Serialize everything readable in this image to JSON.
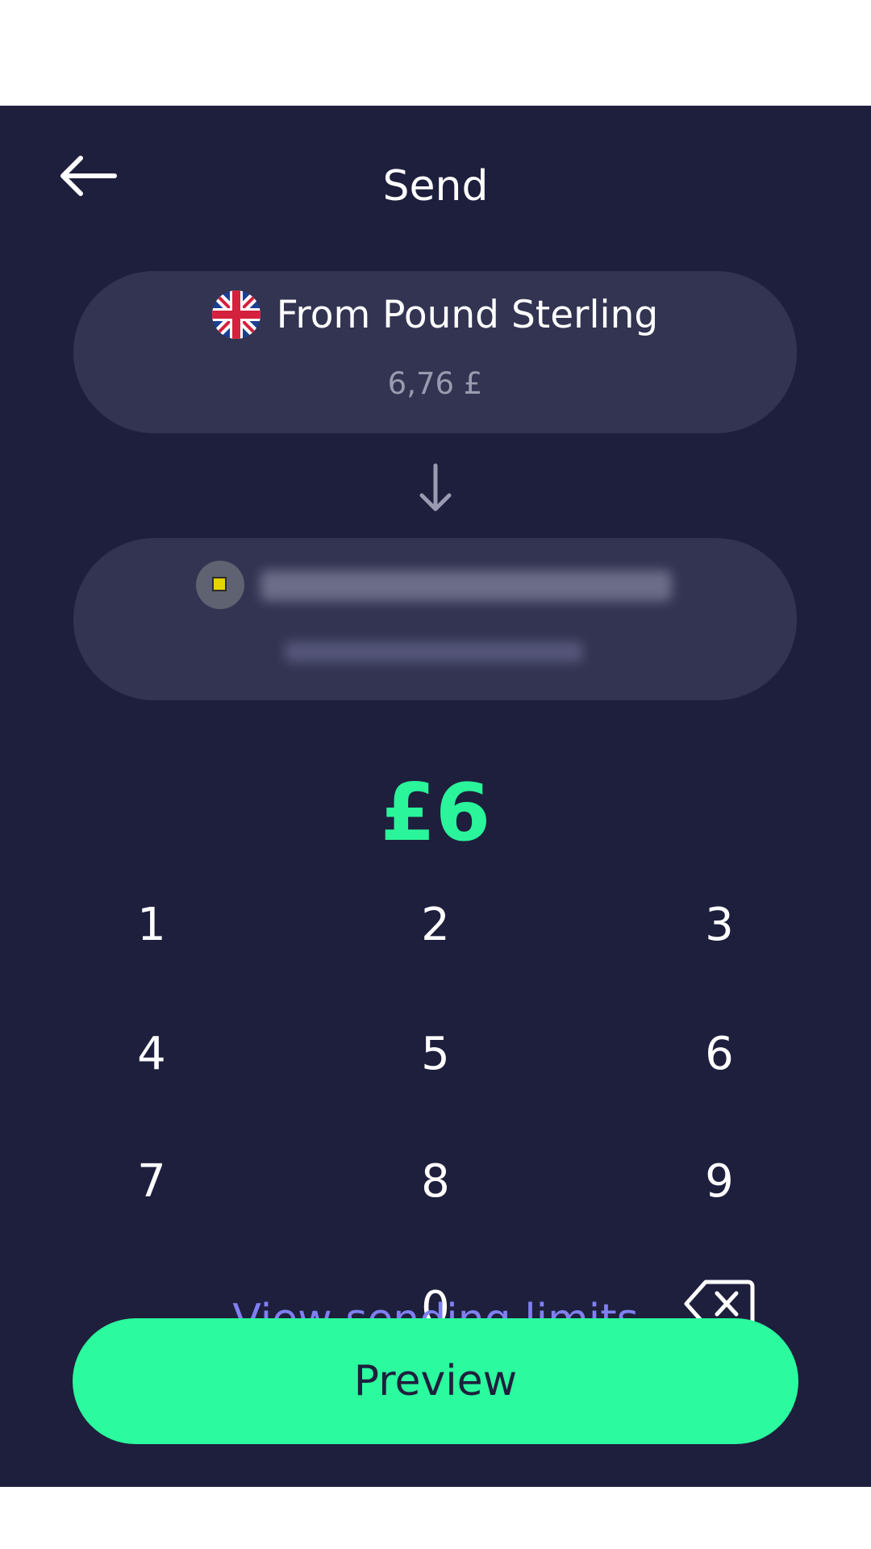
{
  "header": {
    "title": "Send",
    "back_icon": "arrow-left-icon"
  },
  "from_card": {
    "label": "From Pound Sterling",
    "balance": "6,76 £",
    "flag_icon": "uk-flag-icon"
  },
  "to_card": {
    "recipient_icon": "recipient-avatar-icon",
    "name_redacted": true
  },
  "amount": {
    "value": "£6",
    "color": "#2bf59a"
  },
  "keypad": {
    "keys": [
      "1",
      "2",
      "3",
      "4",
      "5",
      "6",
      "7",
      "8",
      "9",
      "0"
    ],
    "backspace_icon": "backspace-icon"
  },
  "links": {
    "view_limits": "View sending limits"
  },
  "actions": {
    "preview_label": "Preview"
  },
  "colors": {
    "background": "#1e1f3d",
    "card": "#333452",
    "accent": "#2bfa9e",
    "link": "#8080f2"
  }
}
